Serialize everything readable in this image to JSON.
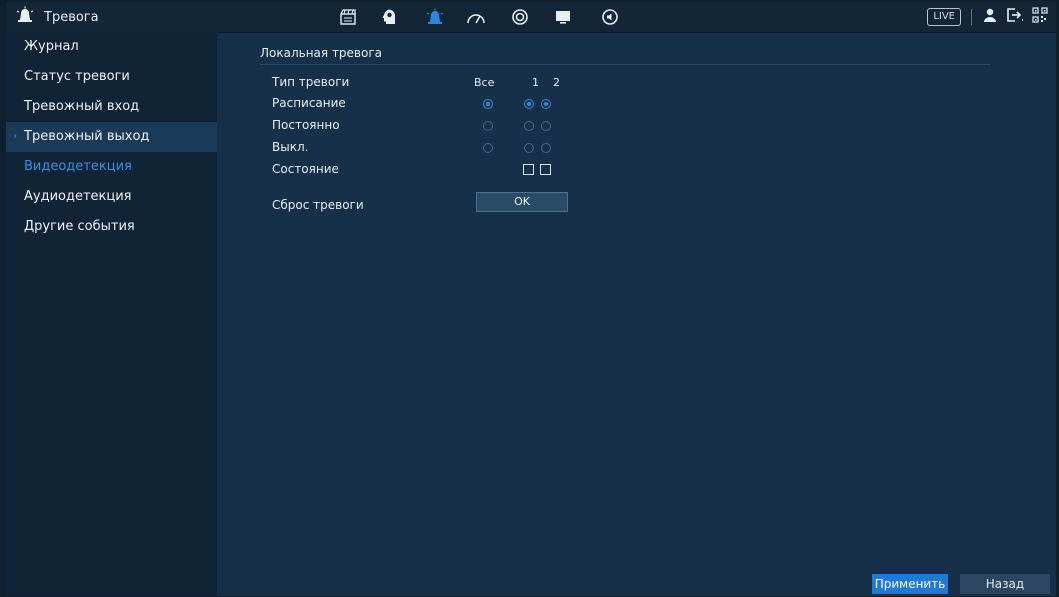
{
  "header": {
    "title": "Тревога",
    "title_icon": "alarm-siren-icon",
    "nav_icons": [
      "camera-icon",
      "smart-analytics-icon",
      "alarm-siren-icon",
      "speedometer-icon",
      "storage-disk-icon",
      "display-monitor-icon",
      "audio-icon"
    ],
    "live_label": "LIVE",
    "right_icons": [
      "user-icon",
      "logout-icon",
      "qr-code-icon"
    ]
  },
  "sidebar": {
    "items": [
      {
        "label": "Журнал"
      },
      {
        "label": "Статус тревоги"
      },
      {
        "label": "Тревожный вход"
      },
      {
        "label": "Тревожный выход"
      },
      {
        "label": "Видеодетекция"
      },
      {
        "label": "Аудиодетекция"
      },
      {
        "label": "Другие события"
      }
    ],
    "selected_index": 3,
    "active_index": 4
  },
  "main": {
    "section_title": "Локальная тревога",
    "type_label": "Тип тревоги",
    "columns": [
      "Все",
      "1",
      "2"
    ],
    "rows": [
      {
        "label": "Расписание",
        "all": true,
        "ch1": true,
        "ch2": true
      },
      {
        "label": "Постоянно",
        "all": false,
        "ch1": false,
        "ch2": false
      },
      {
        "label": "Выкл.",
        "all": false,
        "ch1": false,
        "ch2": false
      }
    ],
    "status_label": "Состояние",
    "status_values": [
      false,
      false
    ],
    "reset_label": "Сброс тревоги",
    "reset_button": "OK"
  },
  "footer": {
    "apply_label": "Применить",
    "back_label": "Назад"
  },
  "colors": {
    "accent": "#1f7ad0",
    "active_text": "#3e8de0",
    "background": "#173049",
    "sidebar": "#112337"
  }
}
